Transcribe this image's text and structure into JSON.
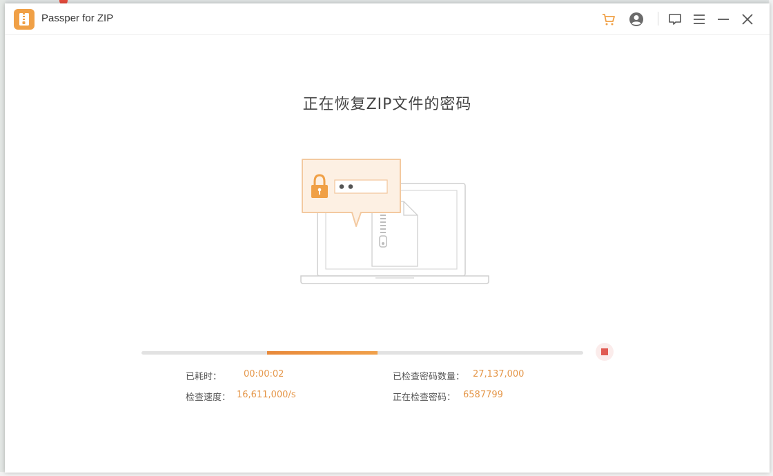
{
  "window": {
    "title": "Passper for ZIP"
  },
  "titlebar_icons": [
    "cart-icon",
    "user-icon",
    "feedback-icon",
    "menu-icon",
    "minimize-icon",
    "close-icon"
  ],
  "colors": {
    "accent": "#f0a046",
    "progress": "#e8893a",
    "stop": "#e05a52",
    "value_text": "#e5974a"
  },
  "main": {
    "heading": "正在恢复ZIP文件的密码"
  },
  "progress": {
    "segment_start_fraction": 0.285,
    "segment_end_fraction": 0.535
  },
  "stats": {
    "elapsed_label": "已耗时：",
    "elapsed_value": "00:00:02",
    "speed_label": "检查速度：",
    "speed_value": "16,611,000/s",
    "checked_label": "已检查密码数量：",
    "checked_value": "27,137,000",
    "current_label": "正在检查密码：",
    "current_value": "6587799"
  }
}
